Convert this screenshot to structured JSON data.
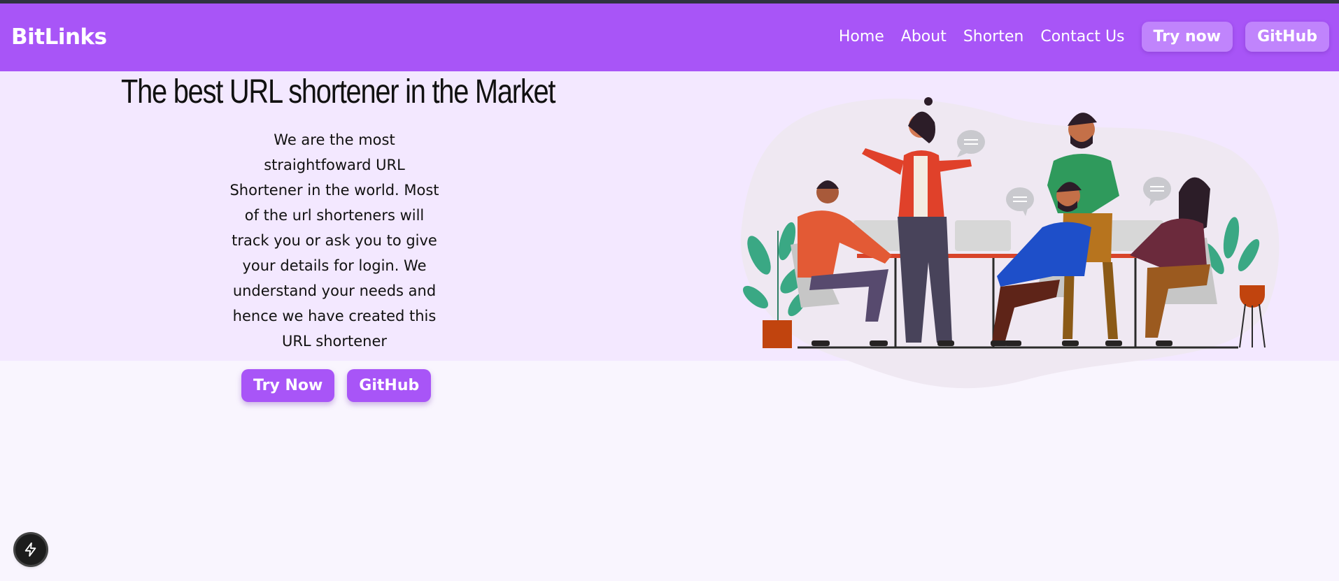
{
  "navbar": {
    "logo": "BitLinks",
    "links": [
      "Home",
      "About",
      "Shorten",
      "Contact Us"
    ],
    "try_now": "Try now",
    "github": "GitHub"
  },
  "hero": {
    "title": "The best URL shortener in the Market",
    "description": "We are the most straightfoward URL Shortener in the world. Most of the url shorteners will track you or ask you to give your details for login. We understand your needs and hence we have created this URL shortener",
    "try_now": "Try Now",
    "github": "GitHub",
    "illustration": "team-meeting-illustration"
  },
  "dev_indicator": {
    "icon": "lightning-bolt-icon"
  },
  "colors": {
    "brand": "#a855f7",
    "hero_bg": "#f3e8ff",
    "page_bg": "#f9f5fe",
    "nav_button": "#c084fc"
  }
}
